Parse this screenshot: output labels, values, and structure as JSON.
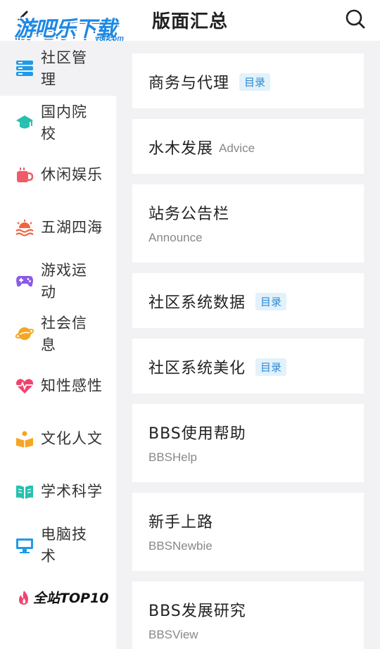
{
  "header": {
    "back_icon": "back-chevron-icon",
    "logo_text": "游吧乐下载",
    "logo_sub": "y8l.com",
    "title": "版面汇总",
    "search_icon": "search-icon"
  },
  "sidebar": {
    "items": [
      {
        "label": "社区管理",
        "icon": "database-icon",
        "color": "#1e9be9",
        "active": true
      },
      {
        "label": "国内院校",
        "icon": "graduation-cap-icon",
        "color": "#26c0b0"
      },
      {
        "label": "休闲娱乐",
        "icon": "cup-icon",
        "color": "#f05b6a"
      },
      {
        "label": "五湖四海",
        "icon": "sunset-waves-icon",
        "color": "#f2633f"
      },
      {
        "label": "游戏运动",
        "icon": "gamepad-icon",
        "color": "#8b5be8"
      },
      {
        "label": "社会信息",
        "icon": "planet-icon",
        "color": "#f5a623"
      },
      {
        "label": "知性感性",
        "icon": "heartbeat-icon",
        "color": "#f0436c"
      },
      {
        "label": "文化人文",
        "icon": "reader-icon",
        "color": "#f5a623"
      },
      {
        "label": "学术科学",
        "icon": "open-book-icon",
        "color": "#26c0b0"
      },
      {
        "label": "电脑技术",
        "icon": "monitor-icon",
        "color": "#1e9be9"
      }
    ],
    "top10_label": "全站TOP10"
  },
  "boards": [
    {
      "title": "商务与代理",
      "tag": "目录"
    },
    {
      "title": "水木发展",
      "inline_sub": "Advice"
    },
    {
      "title": "站务公告栏",
      "sub": "Announce"
    },
    {
      "title": "社区系统数据",
      "tag": "目录"
    },
    {
      "title": "社区系统美化",
      "tag": "目录"
    },
    {
      "title": "BBS使用帮助",
      "sub": "BBSHelp"
    },
    {
      "title": "新手上路",
      "sub": "BBSNewbie"
    },
    {
      "title": "BBS发展研究",
      "sub": "BBSView"
    }
  ]
}
